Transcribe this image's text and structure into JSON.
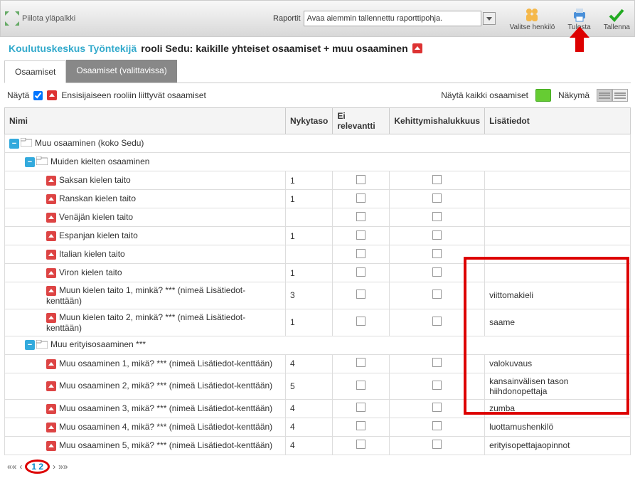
{
  "toolbar": {
    "hide_label": "Piilota yläpalkki",
    "report_label": "Raportit",
    "report_placeholder": "Avaa aiemmin tallennettu raporttipohja.",
    "buttons": {
      "select_person": "Valitse henkilö",
      "print": "Tulosta",
      "save": "Tallenna"
    }
  },
  "title": {
    "org": "Koulutuskeskus Työntekijä",
    "role": "rooli Sedu: kaikille yhteiset osaamiset + muu osaaminen"
  },
  "tabs": {
    "active": "Osaamiset",
    "inactive": "Osaamiset (valittavissa)"
  },
  "filter": {
    "show_label": "Näytä",
    "primary_label": "Ensisijaiseen rooliin liittyvät osaamiset",
    "show_all": "Näytä kaikki osaamiset",
    "view_label": "Näkymä"
  },
  "columns": {
    "name": "Nimi",
    "level": "Nykytaso",
    "relevant": "Ei relevantti",
    "develop": "Kehittymishalukkuus",
    "info": "Lisätiedot"
  },
  "groups": [
    {
      "label": "Muu osaaminen (koko Sedu)",
      "indent": 0
    },
    {
      "label": "Muiden kielten osaaminen",
      "indent": 1
    }
  ],
  "rows": [
    {
      "name": "Saksan kielen taito",
      "level": "1",
      "info": ""
    },
    {
      "name": "Ranskan kielen taito",
      "level": "1",
      "info": ""
    },
    {
      "name": "Venäjän kielen taito",
      "level": "",
      "info": ""
    },
    {
      "name": "Espanjan kielen taito",
      "level": "1",
      "info": ""
    },
    {
      "name": "Italian kielen taito",
      "level": "",
      "info": ""
    },
    {
      "name": "Viron kielen taito",
      "level": "1",
      "info": ""
    },
    {
      "name": "Muun kielen taito 1, minkä? *** (nimeä Lisätiedot-kenttään)",
      "level": "3",
      "info": "viittomakieli"
    },
    {
      "name": "Muun kielen taito 2, minkä? *** (nimeä Lisätiedot-kenttään)",
      "level": "1",
      "info": "saame"
    }
  ],
  "group2": {
    "label": "Muu erityisosaaminen ***",
    "indent": 1
  },
  "rows2": [
    {
      "name": "Muu osaaminen 1, mikä? *** (nimeä Lisätiedot-kenttään)",
      "level": "4",
      "info": "valokuvaus"
    },
    {
      "name": "Muu osaaminen 2, mikä? *** (nimeä Lisätiedot-kenttään)",
      "level": "5",
      "info": "kansainvälisen tason hiihdonopettaja"
    },
    {
      "name": "Muu osaaminen 3, mikä? *** (nimeä Lisätiedot-kenttään)",
      "level": "4",
      "info": "zumba"
    },
    {
      "name": "Muu osaaminen 4, mikä? *** (nimeä Lisätiedot-kenttään)",
      "level": "4",
      "info": "luottamushenkilö"
    },
    {
      "name": "Muu osaaminen 5, mikä? *** (nimeä Lisätiedot-kenttään)",
      "level": "4",
      "info": "erityisopettajaopinnot"
    }
  ],
  "pager": {
    "p1": "1",
    "p2": "2"
  }
}
